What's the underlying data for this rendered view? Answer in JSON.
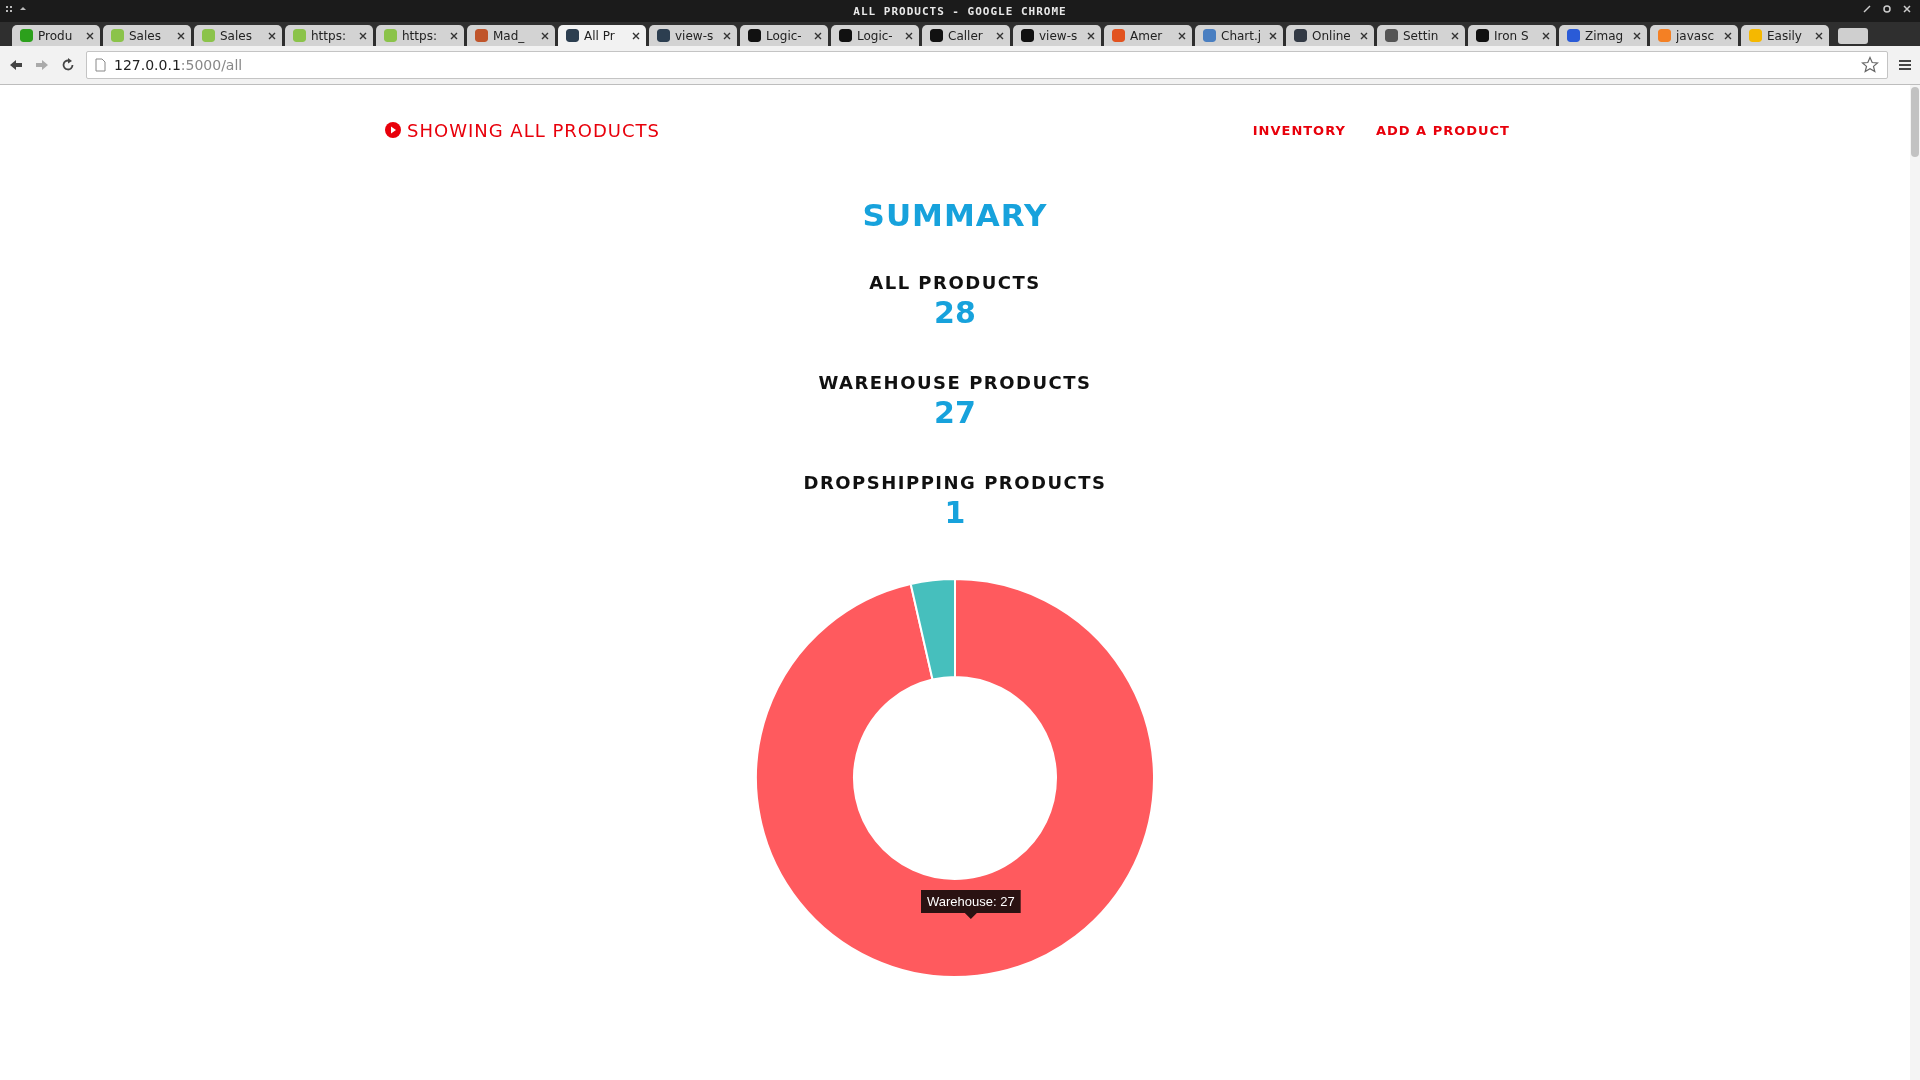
{
  "window": {
    "title": "ALL PRODUCTS - GOOGLE CHROME"
  },
  "tabs": [
    {
      "label": "Produ",
      "selected": false,
      "color": "#2ca01c"
    },
    {
      "label": "Sales",
      "selected": false,
      "color": "#8bc34a"
    },
    {
      "label": "Sales",
      "selected": false,
      "color": "#8bc34a"
    },
    {
      "label": "https:",
      "selected": false,
      "color": "#8bc34a"
    },
    {
      "label": "https:",
      "selected": false,
      "color": "#8bc34a"
    },
    {
      "label": "Mad_",
      "selected": false,
      "color": "#c0552b"
    },
    {
      "label": "All Pr",
      "selected": true,
      "color": "#2c3e50"
    },
    {
      "label": "view-s",
      "selected": false,
      "color": "#2c3e50"
    },
    {
      "label": "Logic-",
      "selected": false,
      "color": "#111111"
    },
    {
      "label": "Logic-",
      "selected": false,
      "color": "#111111"
    },
    {
      "label": "Caller",
      "selected": false,
      "color": "#111111"
    },
    {
      "label": "view-s",
      "selected": false,
      "color": "#111111"
    },
    {
      "label": "Amer",
      "selected": false,
      "color": "#e2531f"
    },
    {
      "label": "Chart.j",
      "selected": false,
      "color": "#4a7fc1"
    },
    {
      "label": "Online",
      "selected": false,
      "color": "#333a45"
    },
    {
      "label": "Settin",
      "selected": false,
      "color": "#555555"
    },
    {
      "label": "Iron S",
      "selected": false,
      "color": "#111111"
    },
    {
      "label": "Zimag",
      "selected": false,
      "color": "#2a5bd7"
    },
    {
      "label": "javasc",
      "selected": false,
      "color": "#f48024"
    },
    {
      "label": "Easily",
      "selected": false,
      "color": "#f5b800"
    }
  ],
  "address": {
    "host": "127.0.0.1",
    "path": ":5000/all"
  },
  "header": {
    "title": "SHOWING ALL PRODUCTS",
    "nav": [
      "INVENTORY",
      "ADD A PRODUCT"
    ]
  },
  "summary": {
    "heading": "SUMMARY",
    "stats": [
      {
        "label": "ALL PRODUCTS",
        "value": "28"
      },
      {
        "label": "WAREHOUSE PRODUCTS",
        "value": "27"
      },
      {
        "label": "DROPSHIPPING PRODUCTS",
        "value": "1"
      }
    ],
    "chart": {
      "tooltip": "Warehouse: 27"
    }
  }
}
